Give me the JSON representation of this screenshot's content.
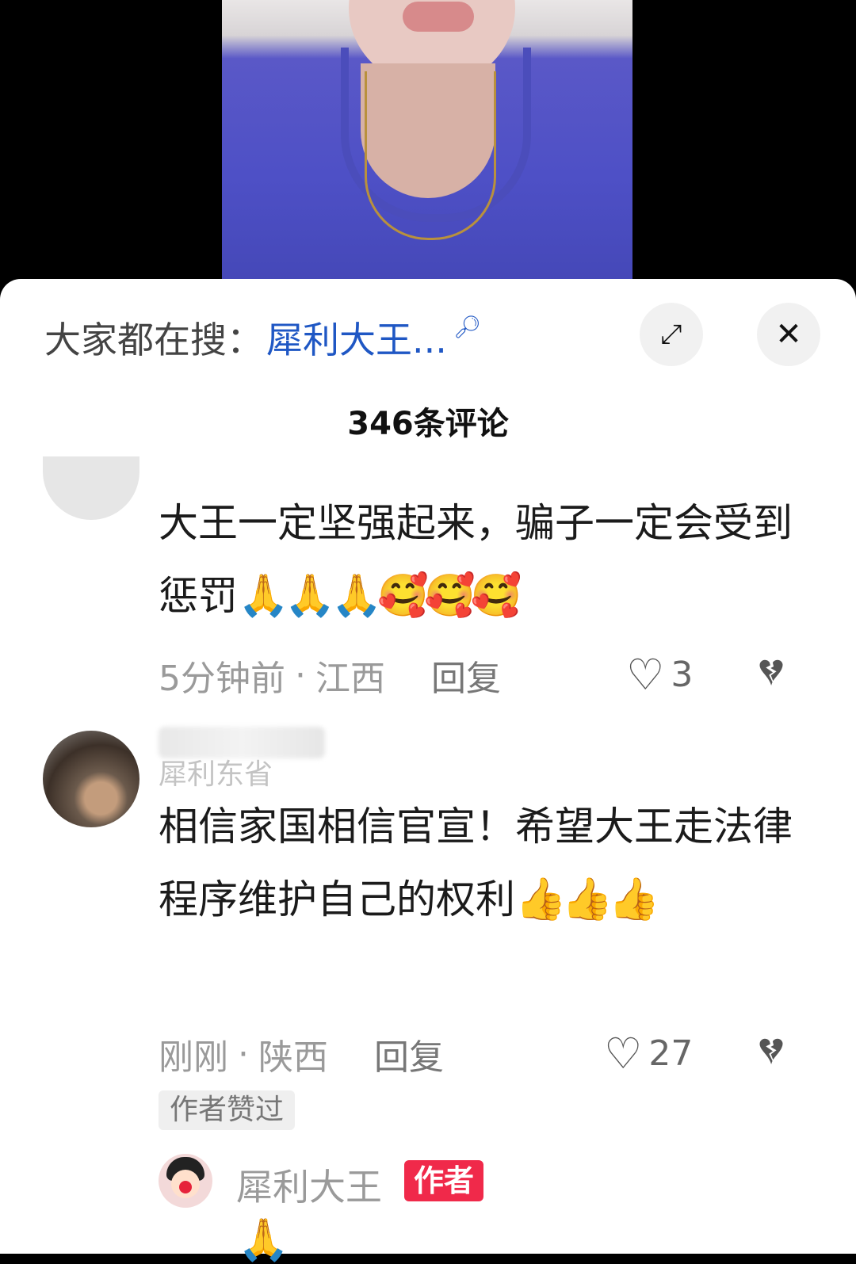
{
  "search": {
    "prefix": "大家都在搜：",
    "keyword": "犀利大王...",
    "search_icon": "search-icon"
  },
  "buttons": {
    "expand_icon": "⤢",
    "close_icon": "✕"
  },
  "comment_count": "346条评论",
  "comments": [
    {
      "text": "大王一定坚强起来，骗子一定会受到惩罚",
      "emojis": "🙏🙏🙏🥰🥰🥰",
      "time": "5分钟前",
      "location": "江西",
      "reply_label": "回复",
      "likes": "3"
    },
    {
      "username_partial": "犀利东省",
      "text": "相信家国相信官宣！希望大王走法律程序维护自己的权利",
      "emojis": "👍👍👍",
      "time": "刚刚",
      "location": "陕西",
      "reply_label": "回复",
      "likes": "27",
      "author_liked": "作者赞过"
    }
  ],
  "reply": {
    "name": "犀利大王",
    "badge": "作者",
    "partial_emoji": "🙏"
  },
  "meta_separator": "·"
}
